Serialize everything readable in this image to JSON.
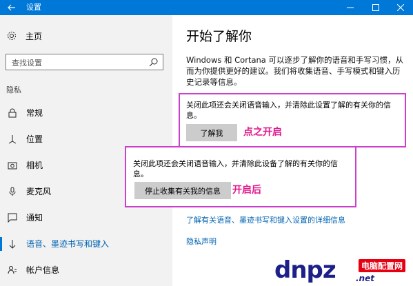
{
  "window": {
    "title": "设置",
    "back_icon": "back-arrow-icon",
    "minimize_icon": "minimize-icon",
    "maximize_icon": "maximize-icon",
    "close_icon": "close-icon",
    "accent": "#0078d7"
  },
  "sidebar": {
    "home_label": "主页",
    "search_placeholder": "查找设置",
    "section_title": "隐私",
    "items": [
      {
        "label": "常规",
        "icon": "lock-icon"
      },
      {
        "label": "位置",
        "icon": "location-icon"
      },
      {
        "label": "相机",
        "icon": "camera-icon"
      },
      {
        "label": "麦克风",
        "icon": "microphone-icon"
      },
      {
        "label": "通知",
        "icon": "notification-icon"
      },
      {
        "label": "语音、墨迹书写和键入",
        "icon": "pen-icon",
        "active": true
      },
      {
        "label": "帐户信息",
        "icon": "account-info-icon"
      }
    ]
  },
  "main": {
    "title": "开始了解你",
    "description": "Windows 和 Cortana 可以逐步了解你的语音和手写习惯，从而为你提供更好的建议。我们将收集语音、手写模式和键入历史记录等信息。",
    "box1": {
      "text": "关闭此项还会关闭语音输入，并清除此设置了解的有关你的信息。",
      "button_label": "了解我",
      "annotation": "点之开启"
    },
    "box2": {
      "text": "关闭此项还会关闭语音输入，并清除此设备了解的有关你的信息。",
      "button_label": "停止收集有关我的信息",
      "annotation": "开启后"
    },
    "link1": "了解有关语音、墨迹书写和键入设置的详细信息",
    "link2": "隐私声明"
  },
  "watermark": {
    "logo": "dnpz",
    "badge": "电脑配置网",
    "url": ".net"
  }
}
